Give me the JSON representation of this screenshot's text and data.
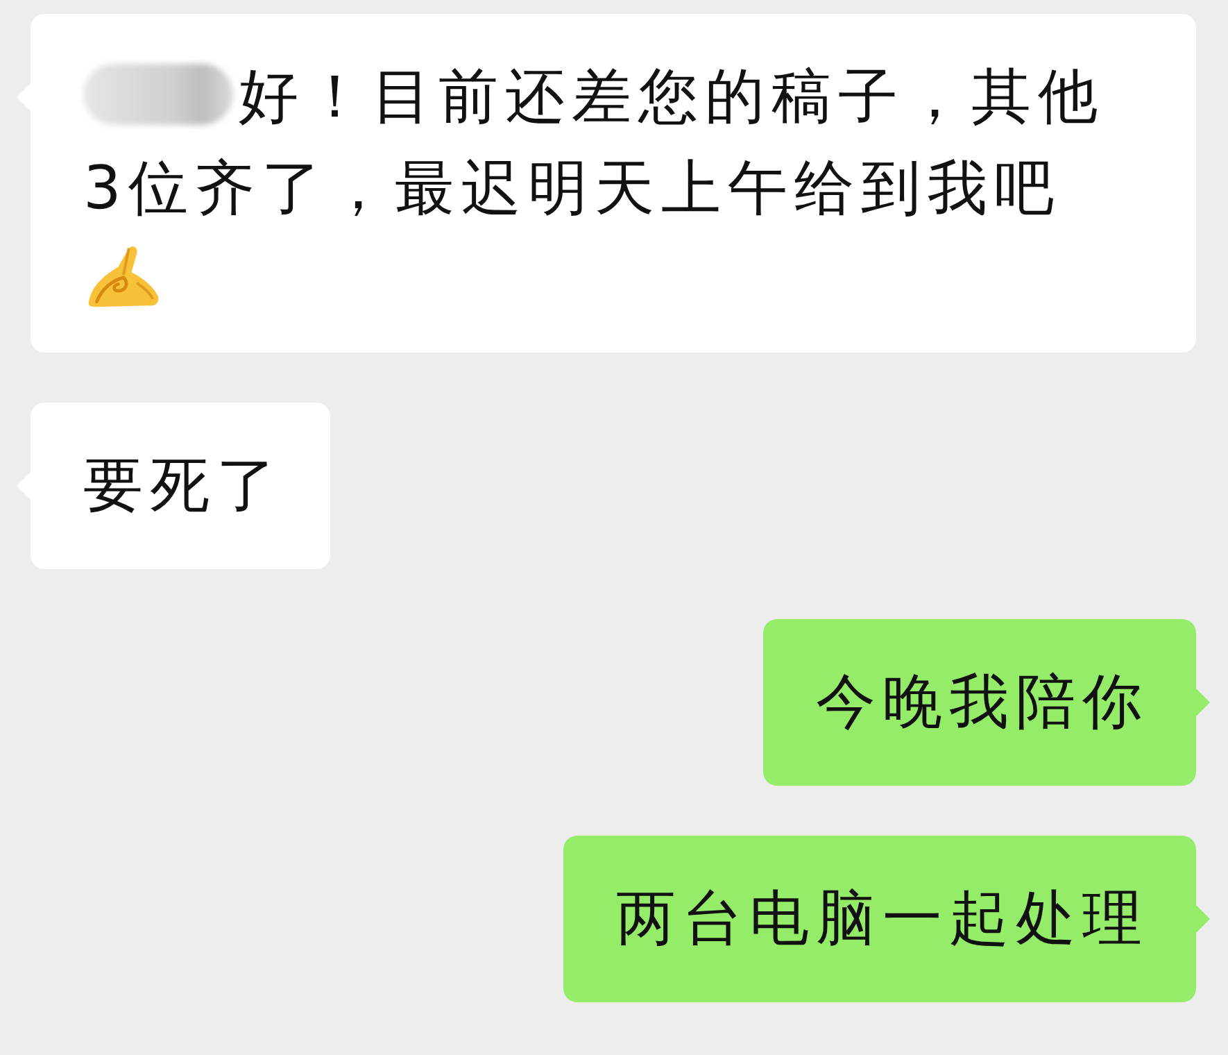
{
  "messages": [
    {
      "kind": "incoming",
      "redacted": true,
      "text": "好！目前还差您的稿子，其他3位齐了，最迟明天上午给到我吧",
      "emoji": true
    },
    {
      "kind": "incoming",
      "text": "要死了"
    },
    {
      "kind": "outgoing",
      "text": "今晚我陪你"
    },
    {
      "kind": "outgoing",
      "text": "两台电脑一起处理"
    }
  ]
}
